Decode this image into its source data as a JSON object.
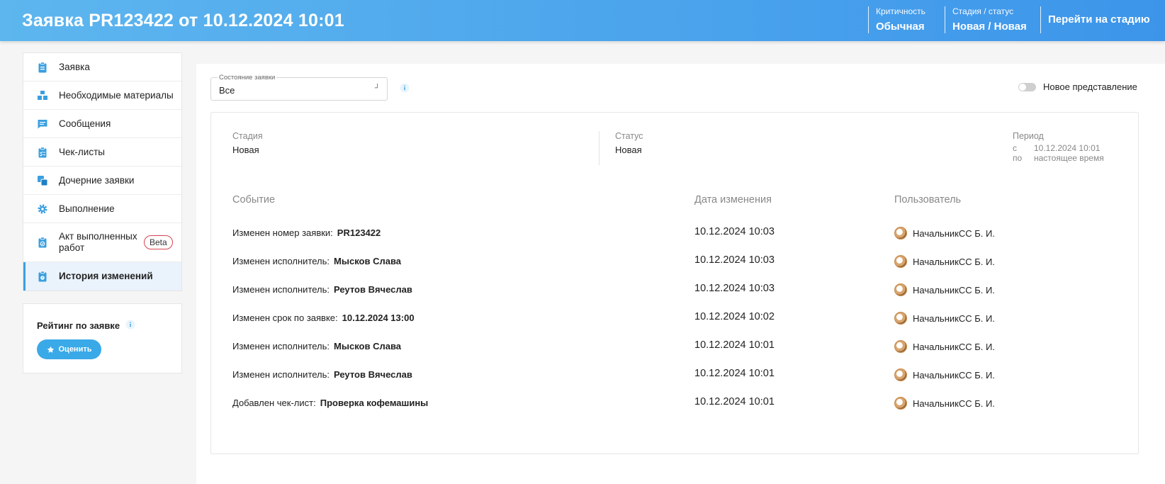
{
  "header": {
    "title": "Заявка PR123422 от 10.12.2024 10:01",
    "criticality_label": "Критичность",
    "criticality_value": "Обычная",
    "stage_label": "Стадия / статус",
    "stage_value": "Новая / Новая",
    "goto_label": "Перейти на стадию"
  },
  "sidebar": {
    "items": [
      {
        "label": "Заявка",
        "icon": "clipboard-icon"
      },
      {
        "label": "Необходимые материалы",
        "icon": "boxes-icon"
      },
      {
        "label": "Сообщения",
        "icon": "message-icon"
      },
      {
        "label": "Чек-листы",
        "icon": "checklist-icon"
      },
      {
        "label": "Дочерние заявки",
        "icon": "child-requests-icon"
      },
      {
        "label": "Выполнение",
        "icon": "gear-icon"
      },
      {
        "label": "Акт выполненных работ",
        "icon": "act-icon",
        "badge": "Beta"
      },
      {
        "label": "История изменений",
        "icon": "history-icon",
        "active": true
      }
    ]
  },
  "rating": {
    "title": "Рейтинг по заявке",
    "button": "Оценить"
  },
  "filter": {
    "label": "Состояние заявки",
    "value": "Все"
  },
  "view_toggle": {
    "label": "Новое представление",
    "on": false
  },
  "summary": {
    "stage_label": "Стадия",
    "stage_value": "Новая",
    "status_label": "Статус",
    "status_value": "Новая",
    "period_label": "Период",
    "from_label": "с",
    "from_value": "10.12.2024 10:01",
    "to_label": "по",
    "to_value": "настоящее время"
  },
  "table": {
    "headers": [
      "Событие",
      "Дата изменения",
      "Пользователь"
    ],
    "rows": [
      {
        "event": "Изменен номер заявки:",
        "value": "PR123422",
        "date": "10.12.2024 10:03",
        "user": "НачальникСС Б. И."
      },
      {
        "event": "Изменен исполнитель:",
        "value": "Мысков Слава",
        "date": "10.12.2024 10:03",
        "user": "НачальникСС Б. И."
      },
      {
        "event": "Изменен исполнитель:",
        "value": "Реутов Вячеслав",
        "date": "10.12.2024 10:03",
        "user": "НачальникСС Б. И."
      },
      {
        "event": "Изменен срок по заявке:",
        "value": "10.12.2024 13:00",
        "date": "10.12.2024 10:02",
        "user": "НачальникСС Б. И."
      },
      {
        "event": "Изменен исполнитель:",
        "value": "Мысков Слава",
        "date": "10.12.2024 10:01",
        "user": "НачальникСС Б. И."
      },
      {
        "event": "Изменен исполнитель:",
        "value": "Реутов Вячеслав",
        "date": "10.12.2024 10:01",
        "user": "НачальникСС Б. И."
      },
      {
        "event": "Добавлен чек-лист:",
        "value": "Проверка кофемашины",
        "date": "10.12.2024 10:01",
        "user": "НачальникСС Б. И."
      }
    ]
  },
  "colors": {
    "accent": "#3aa0e4",
    "header_start": "#5db6ee",
    "header_end": "#3d95ea",
    "beta_border": "#d64550"
  }
}
